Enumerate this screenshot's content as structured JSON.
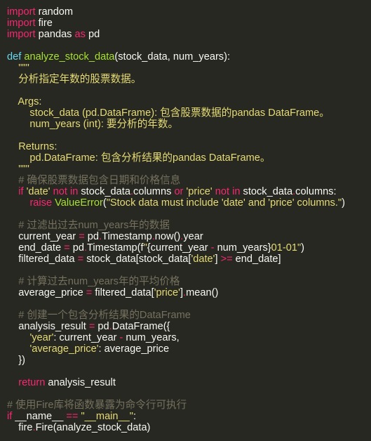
{
  "theme": {
    "background": "#272822",
    "foreground": "#f8f8f2",
    "keyword": "#f92672",
    "function_name": "#a6e22e",
    "builtin": "#66d9ef",
    "string": "#e6db74",
    "comment": "#75715e",
    "number": "#ae81ff"
  },
  "code": {
    "lines": [
      [
        [
          "keyword",
          "import"
        ],
        [
          "plain",
          " random"
        ]
      ],
      [
        [
          "keyword",
          "import"
        ],
        [
          "plain",
          " fire"
        ]
      ],
      [
        [
          "keyword",
          "import"
        ],
        [
          "plain",
          " pandas "
        ],
        [
          "keyword",
          "as"
        ],
        [
          "plain",
          " pd"
        ]
      ],
      [],
      [
        [
          "builtin",
          "def"
        ],
        [
          "plain",
          " "
        ],
        [
          "funcname",
          "analyze_stock_data"
        ],
        [
          "plain",
          "(stock_data, num_years):"
        ]
      ],
      [
        [
          "docstring",
          "    \"\"\""
        ]
      ],
      [
        [
          "docstring",
          "    分析指定年数的股票数据。"
        ]
      ],
      [],
      [
        [
          "docstring",
          "    Args:"
        ]
      ],
      [
        [
          "docstring",
          "        stock_data (pd.DataFrame): 包含股票数据的pandas DataFrame。"
        ]
      ],
      [
        [
          "docstring",
          "        num_years (int): 要分析的年数。"
        ]
      ],
      [],
      [
        [
          "docstring",
          "    Returns:"
        ]
      ],
      [
        [
          "docstring",
          "        pd.DataFrame: 包含分析结果的pandas DataFrame。"
        ]
      ],
      [
        [
          "docstring",
          "    \"\"\""
        ]
      ],
      [
        [
          "comment",
          "    # 确保股票数据包含日期和价格信息"
        ]
      ],
      [
        [
          "plain",
          "    "
        ],
        [
          "keyword",
          "if"
        ],
        [
          "plain",
          " "
        ],
        [
          "string",
          "'date'"
        ],
        [
          "plain",
          " "
        ],
        [
          "keyword",
          "not in"
        ],
        [
          "plain",
          " stock_data"
        ],
        [
          "dot",
          "."
        ],
        [
          "plain",
          "columns "
        ],
        [
          "keyword",
          "or"
        ],
        [
          "plain",
          " "
        ],
        [
          "string",
          "'price'"
        ],
        [
          "plain",
          " "
        ],
        [
          "keyword",
          "not in"
        ],
        [
          "plain",
          " stock_data"
        ],
        [
          "dot",
          "."
        ],
        [
          "plain",
          "columns:"
        ]
      ],
      [
        [
          "plain",
          "        "
        ],
        [
          "keyword",
          "raise"
        ],
        [
          "plain",
          " "
        ],
        [
          "funcname",
          "ValueError"
        ],
        [
          "plain",
          "("
        ],
        [
          "string",
          "\"Stock data must include 'date' and 'price' columns.\""
        ],
        [
          "plain",
          ")"
        ]
      ],
      [],
      [
        [
          "comment",
          "    # 过滤出过去num_years年的数据"
        ]
      ],
      [
        [
          "plain",
          "    current_year "
        ],
        [
          "operator",
          "="
        ],
        [
          "plain",
          " pd"
        ],
        [
          "dot",
          "."
        ],
        [
          "plain",
          "Timestamp"
        ],
        [
          "dot",
          "."
        ],
        [
          "plain",
          "now()"
        ],
        [
          "dot",
          "."
        ],
        [
          "plain",
          "year"
        ]
      ],
      [
        [
          "plain",
          "    end_date "
        ],
        [
          "operator",
          "="
        ],
        [
          "plain",
          " pd"
        ],
        [
          "dot",
          "."
        ],
        [
          "plain",
          "Timestamp(f"
        ],
        [
          "string",
          "\""
        ],
        [
          "plain",
          "{current_year "
        ],
        [
          "operator",
          "-"
        ],
        [
          "plain",
          " num_years}"
        ],
        [
          "string",
          "01-01\""
        ],
        [
          "plain",
          ")"
        ]
      ],
      [
        [
          "plain",
          "    filtered_data "
        ],
        [
          "operator",
          "="
        ],
        [
          "plain",
          " stock_data[stock_data["
        ],
        [
          "string",
          "'date'"
        ],
        [
          "plain",
          "] "
        ],
        [
          "operator",
          ">="
        ],
        [
          "plain",
          " end_date]"
        ]
      ],
      [],
      [
        [
          "comment",
          "    # 计算过去num_years年的平均价格"
        ]
      ],
      [
        [
          "plain",
          "    average_price "
        ],
        [
          "operator",
          "="
        ],
        [
          "plain",
          " filtered_data["
        ],
        [
          "string",
          "'price'"
        ],
        [
          "plain",
          "]"
        ],
        [
          "dot",
          "."
        ],
        [
          "plain",
          "mean()"
        ]
      ],
      [],
      [
        [
          "comment",
          "    # 创建一个包含分析结果的DataFrame"
        ]
      ],
      [
        [
          "plain",
          "    analysis_result "
        ],
        [
          "operator",
          "="
        ],
        [
          "plain",
          " pd"
        ],
        [
          "dot",
          "."
        ],
        [
          "plain",
          "DataFrame({"
        ]
      ],
      [
        [
          "plain",
          "        "
        ],
        [
          "string",
          "'year'"
        ],
        [
          "plain",
          ": current_year "
        ],
        [
          "operator",
          "-"
        ],
        [
          "plain",
          " num_years,"
        ]
      ],
      [
        [
          "plain",
          "        "
        ],
        [
          "string",
          "'average_price'"
        ],
        [
          "plain",
          ": average_price"
        ]
      ],
      [
        [
          "plain",
          "    })"
        ]
      ],
      [],
      [
        [
          "plain",
          "    "
        ],
        [
          "keyword",
          "return"
        ],
        [
          "plain",
          " analysis_result"
        ]
      ],
      [],
      [
        [
          "comment",
          "# 使用Fire库将函数暴露为命令行可执行"
        ]
      ],
      [
        [
          "keyword",
          "if"
        ],
        [
          "plain",
          " __name__ "
        ],
        [
          "operator",
          "=="
        ],
        [
          "plain",
          " "
        ],
        [
          "string",
          "\"__main__\""
        ],
        [
          "plain",
          ":"
        ]
      ],
      [
        [
          "plain",
          "    fire"
        ],
        [
          "dot",
          "."
        ],
        [
          "plain",
          "Fire(analyze_stock_data)"
        ]
      ]
    ]
  }
}
